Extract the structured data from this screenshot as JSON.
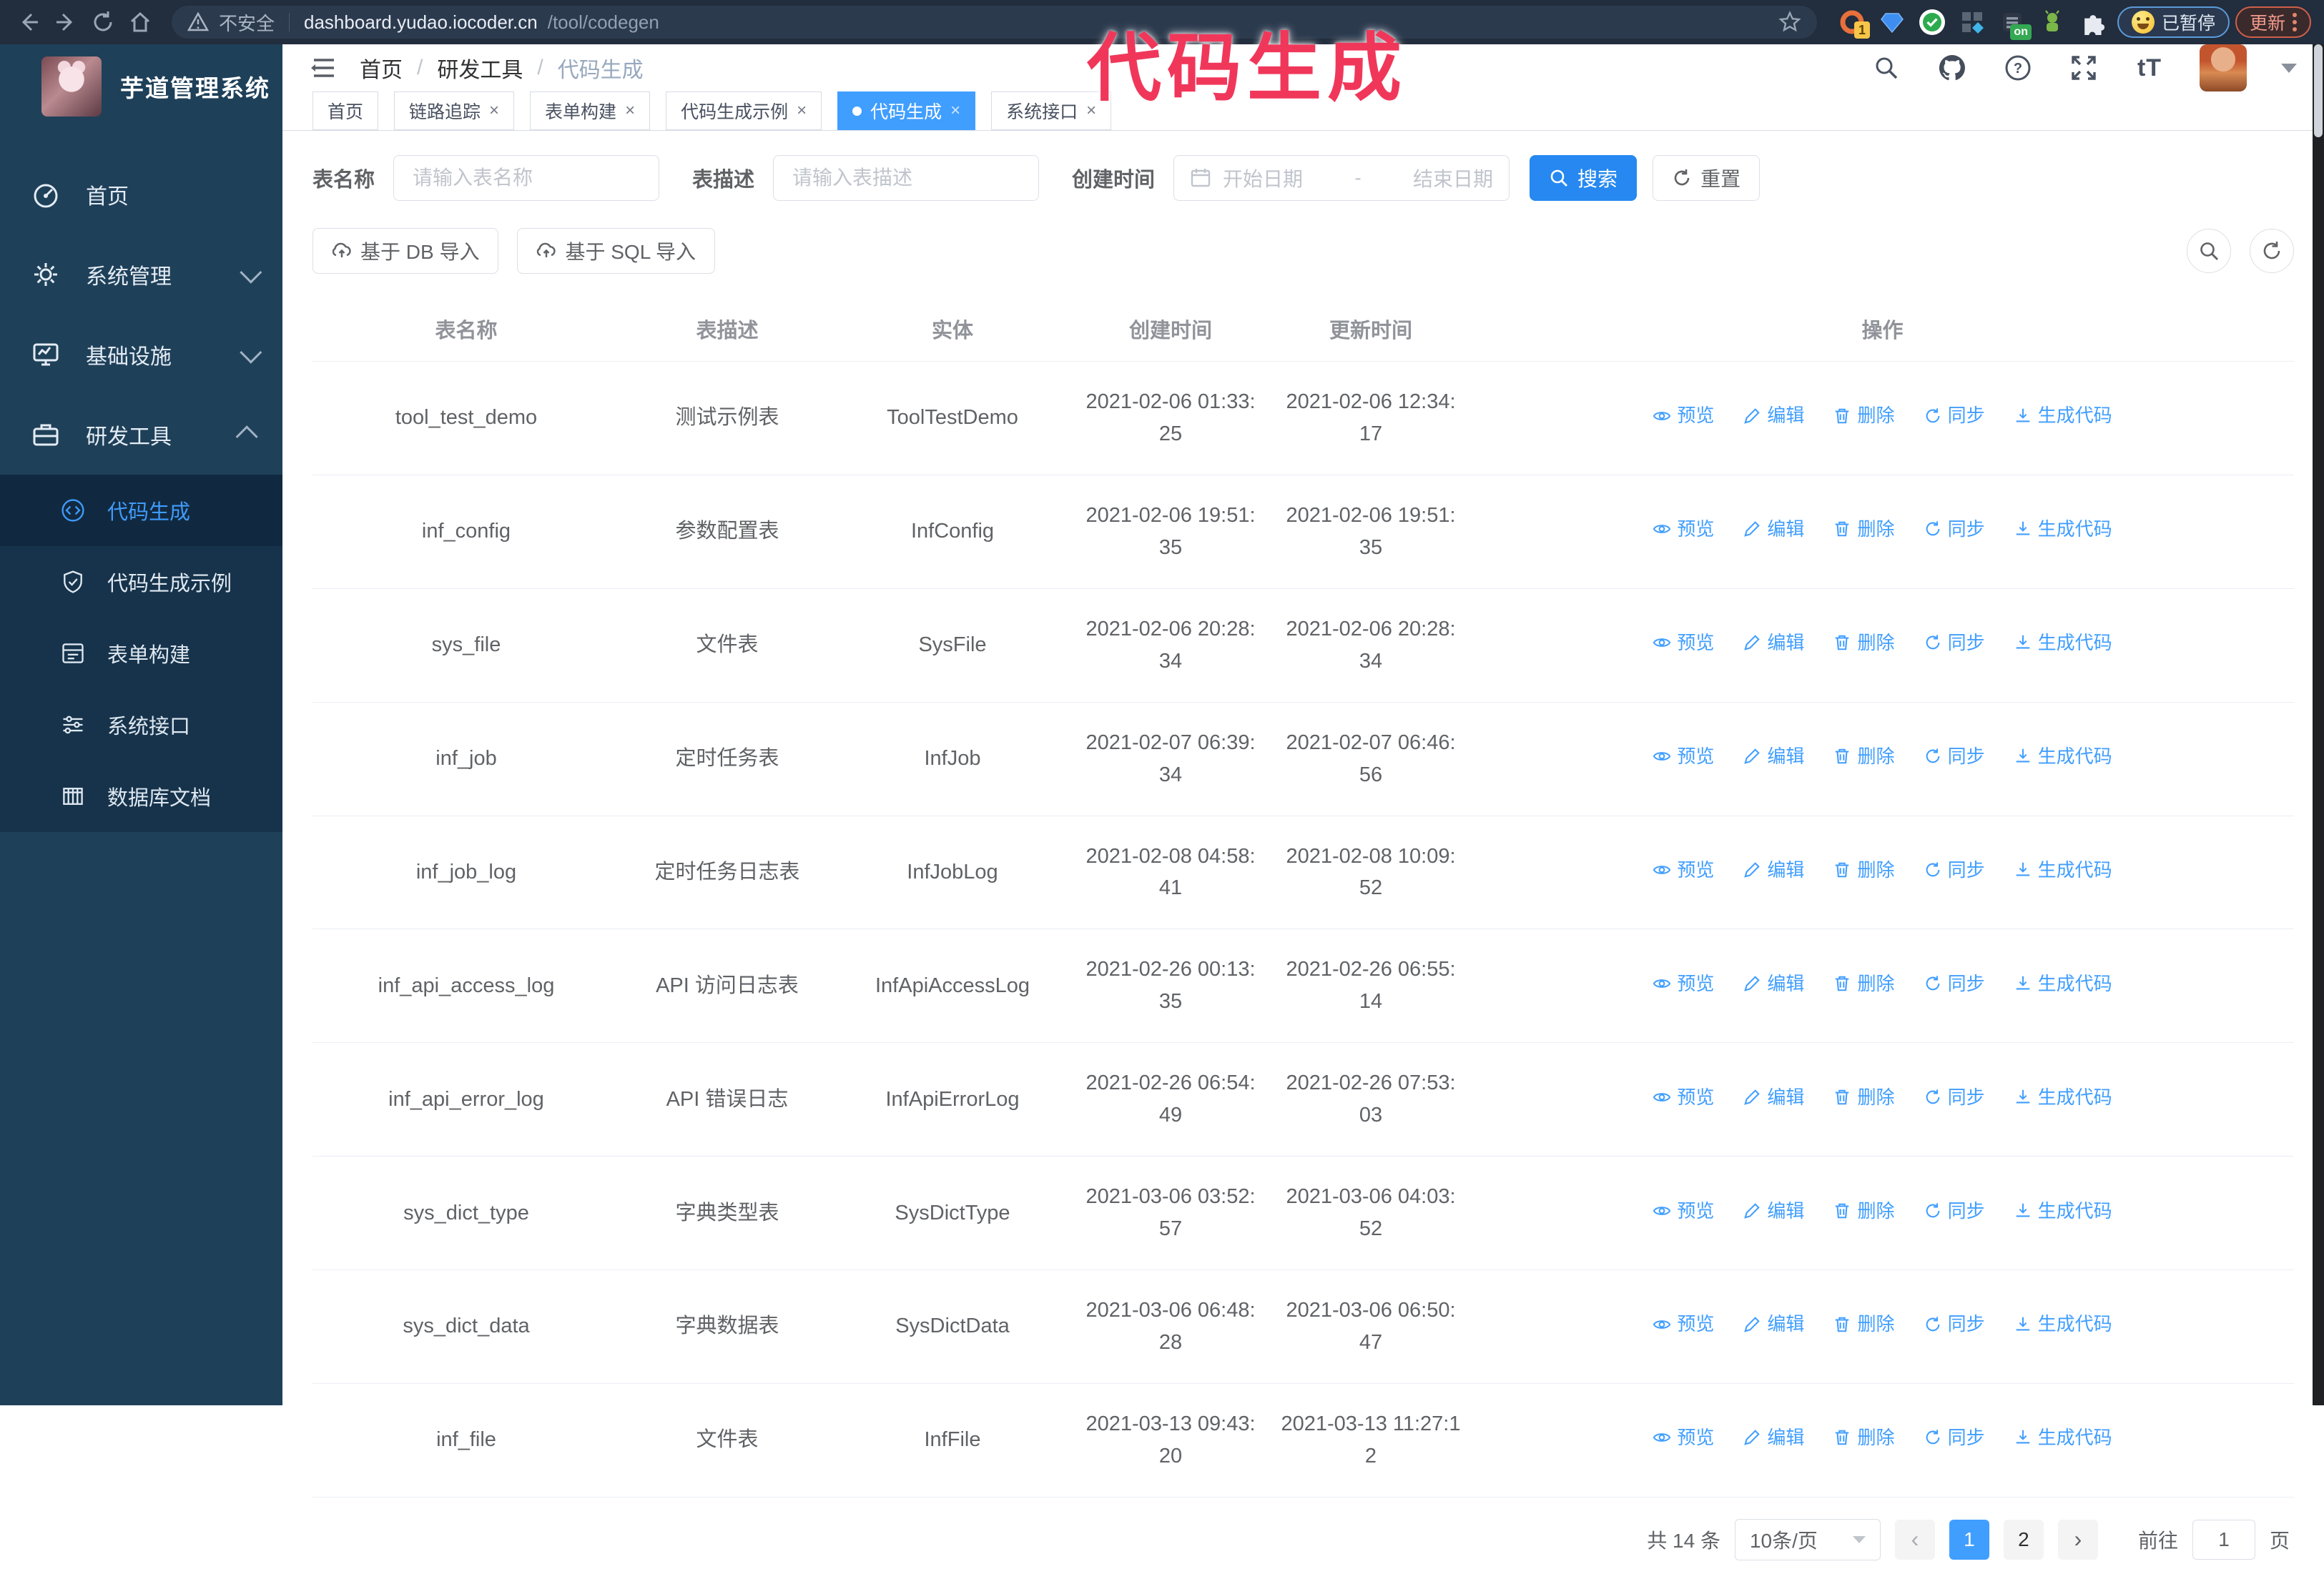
{
  "browser": {
    "security_label": "不安全",
    "url_host": "dashboard.yudao.iocoder.cn",
    "url_path": "/tool/codegen",
    "ext_badge_1": "1",
    "ext_on_badge": "on",
    "paused_badge": "已暂停",
    "update_button": "更新"
  },
  "watermark": "代码生成",
  "sidebar": {
    "logo_title": "芋道管理系统",
    "items": [
      {
        "label": "首页",
        "icon": "dashboard-icon"
      },
      {
        "label": "系统管理",
        "icon": "gear-icon"
      },
      {
        "label": "基础设施",
        "icon": "monitor-icon"
      },
      {
        "label": "研发工具",
        "icon": "toolbox-icon"
      }
    ],
    "subitems": [
      {
        "label": "代码生成",
        "icon": "code-icon",
        "active": true
      },
      {
        "label": "代码生成示例",
        "icon": "shield-check-icon"
      },
      {
        "label": "表单构建",
        "icon": "form-icon"
      },
      {
        "label": "系统接口",
        "icon": "sliders-icon"
      },
      {
        "label": "数据库文档",
        "icon": "database-icon"
      }
    ]
  },
  "header": {
    "breadcrumb": [
      "首页",
      "研发工具",
      "代码生成"
    ],
    "text_size_icon_text": "tT"
  },
  "tabs": [
    {
      "label": "首页",
      "closable": false,
      "active": false
    },
    {
      "label": "链路追踪",
      "closable": true,
      "active": false
    },
    {
      "label": "表单构建",
      "closable": true,
      "active": false
    },
    {
      "label": "代码生成示例",
      "closable": true,
      "active": false
    },
    {
      "label": "代码生成",
      "closable": true,
      "active": true
    },
    {
      "label": "系统接口",
      "closable": true,
      "active": false
    }
  ],
  "filters": {
    "table_name_label": "表名称",
    "table_name_placeholder": "请输入表名称",
    "table_desc_label": "表描述",
    "table_desc_placeholder": "请输入表描述",
    "create_time_label": "创建时间",
    "start_date_placeholder": "开始日期",
    "range_separator": "-",
    "end_date_placeholder": "结束日期",
    "search_label": "搜索",
    "reset_label": "重置"
  },
  "toolbar": {
    "import_db_label": "基于 DB 导入",
    "import_sql_label": "基于 SQL 导入"
  },
  "table": {
    "columns": [
      "表名称",
      "表描述",
      "实体",
      "创建时间",
      "更新时间",
      "操作"
    ],
    "actions": [
      "预览",
      "编辑",
      "删除",
      "同步",
      "生成代码"
    ],
    "rows": [
      {
        "name": "tool_test_demo",
        "desc": "测试示例表",
        "entity": "ToolTestDemo",
        "created": "2021-02-06 01:33:25",
        "updated": "2021-02-06 12:34:17"
      },
      {
        "name": "inf_config",
        "desc": "参数配置表",
        "entity": "InfConfig",
        "created": "2021-02-06 19:51:35",
        "updated": "2021-02-06 19:51:35"
      },
      {
        "name": "sys_file",
        "desc": "文件表",
        "entity": "SysFile",
        "created": "2021-02-06 20:28:34",
        "updated": "2021-02-06 20:28:34"
      },
      {
        "name": "inf_job",
        "desc": "定时任务表",
        "entity": "InfJob",
        "created": "2021-02-07 06:39:34",
        "updated": "2021-02-07 06:46:56"
      },
      {
        "name": "inf_job_log",
        "desc": "定时任务日志表",
        "entity": "InfJobLog",
        "created": "2021-02-08 04:58:41",
        "updated": "2021-02-08 10:09:52"
      },
      {
        "name": "inf_api_access_log",
        "desc": "API 访问日志表",
        "entity": "InfApiAccessLog",
        "created": "2021-02-26 00:13:35",
        "updated": "2021-02-26 06:55:14"
      },
      {
        "name": "inf_api_error_log",
        "desc": "API 错误日志",
        "entity": "InfApiErrorLog",
        "created": "2021-02-26 06:54:49",
        "updated": "2021-02-26 07:53:03"
      },
      {
        "name": "sys_dict_type",
        "desc": "字典类型表",
        "entity": "SysDictType",
        "created": "2021-03-06 03:52:57",
        "updated": "2021-03-06 04:03:52"
      },
      {
        "name": "sys_dict_data",
        "desc": "字典数据表",
        "entity": "SysDictData",
        "created": "2021-03-06 06:48:28",
        "updated": "2021-03-06 06:50:47"
      },
      {
        "name": "inf_file",
        "desc": "文件表",
        "entity": "InfFile",
        "created": "2021-03-13 09:43:20",
        "updated": "2021-03-13 11:27:12"
      }
    ]
  },
  "pagination": {
    "total_label": "共 14 条",
    "page_size_label": "10条/页",
    "pages": [
      "1",
      "2"
    ],
    "active_page": "1",
    "prev_icon": "‹",
    "next_icon": "›",
    "goto_label": "前往",
    "goto_value": "1",
    "page_unit": "页"
  },
  "colors": {
    "accent": "#409eff",
    "primary_button": "#2688f0",
    "sidebar_bg": "#1f4059",
    "submenu_bg": "#16334b",
    "active_item_bg": "#112940",
    "chrome_bg": "#222d3d",
    "watermark": "#f0375a",
    "table_border": "#ebeef5"
  }
}
